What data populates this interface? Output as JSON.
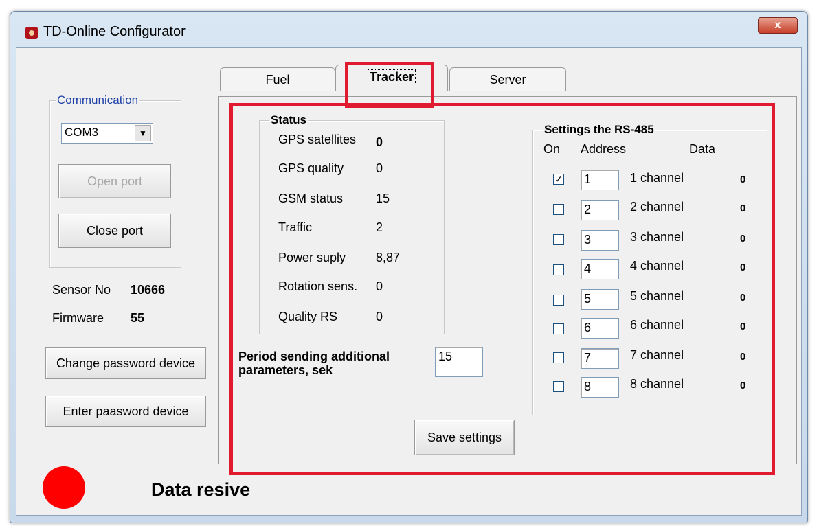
{
  "window": {
    "title": "TD-Online Configurator",
    "close_label": "x"
  },
  "communication": {
    "legend": "Communication",
    "port_value": "COM3",
    "open_port": "Open port",
    "close_port": "Close port"
  },
  "device": {
    "sensor_label": "Sensor No",
    "sensor_value": "10666",
    "firmware_label": "Firmware",
    "firmware_value": "55",
    "change_password": "Change password device",
    "enter_password": "Enter paasword device"
  },
  "tabs": [
    {
      "label": "Fuel"
    },
    {
      "label": "Tracker"
    },
    {
      "label": "Server"
    }
  ],
  "status": {
    "legend": "Status",
    "rows": [
      {
        "label": "GPS satellites",
        "value": "0"
      },
      {
        "label": "GPS quality",
        "value": "0"
      },
      {
        "label": "GSM status",
        "value": "15"
      },
      {
        "label": "Traffic",
        "value": "2"
      },
      {
        "label": "Power suply",
        "value": "8,87"
      },
      {
        "label": "Rotation sens.",
        "value": "0"
      },
      {
        "label": "Quality RS",
        "value": "0"
      }
    ]
  },
  "period": {
    "label_line1": "Period sending additional",
    "label_line2": "parameters, sek",
    "value": "15"
  },
  "rs485": {
    "legend": "Settings the RS-485",
    "col_on": "On",
    "col_address": "Address",
    "col_data": "Data",
    "channels": [
      {
        "checked": "✓",
        "address": "1",
        "name": "1 channel",
        "data": "0"
      },
      {
        "checked": "",
        "address": "2",
        "name": "2 channel",
        "data": "0"
      },
      {
        "checked": "",
        "address": "3",
        "name": "3 channel",
        "data": "0"
      },
      {
        "checked": "",
        "address": "4",
        "name": "4 channel",
        "data": "0"
      },
      {
        "checked": "",
        "address": "5",
        "name": "5 channel",
        "data": "0"
      },
      {
        "checked": "",
        "address": "6",
        "name": "6 channel",
        "data": "0"
      },
      {
        "checked": "",
        "address": "7",
        "name": "7 channel",
        "data": "0"
      },
      {
        "checked": "",
        "address": "8",
        "name": "8 channel",
        "data": "0"
      }
    ]
  },
  "save_settings": "Save settings",
  "data_status": "Data resive",
  "colors": {
    "highlight": "#e01b2f",
    "led": "#ff0000"
  }
}
